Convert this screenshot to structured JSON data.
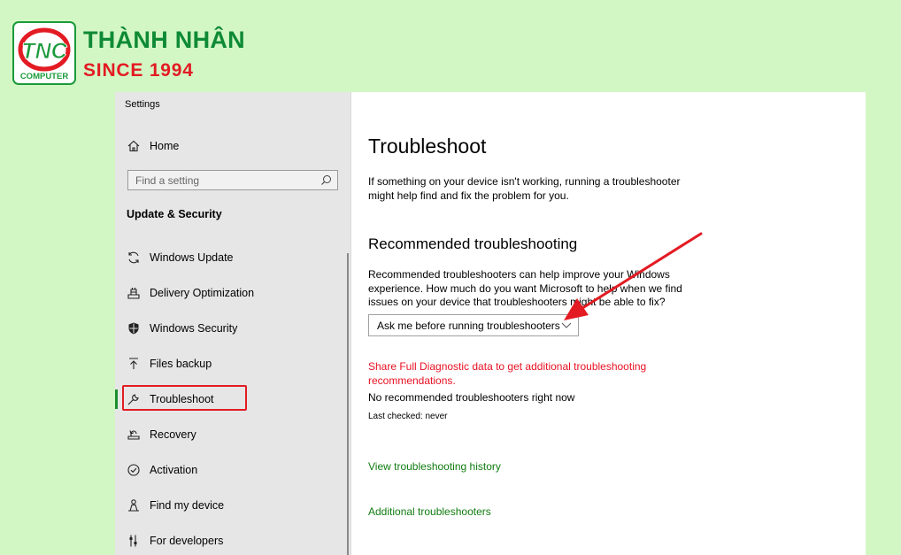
{
  "brand": {
    "logo_text": "TNC",
    "logo_subtext": "COMPUTER",
    "name": "THÀNH NHÂN",
    "since": "SINCE 1994",
    "colors": {
      "green": "#1b9a3b",
      "red": "#e31b23"
    }
  },
  "window": {
    "title": "Settings"
  },
  "sidebar": {
    "home": {
      "label": "Home",
      "icon": "home-icon"
    },
    "search": {
      "placeholder": "Find a setting",
      "icon": "search-icon"
    },
    "section_heading": "Update & Security",
    "items": [
      {
        "label": "Windows Update",
        "icon": "refresh-icon"
      },
      {
        "label": "Delivery Optimization",
        "icon": "delivery-optimization-icon"
      },
      {
        "label": "Windows Security",
        "icon": "shield-icon"
      },
      {
        "label": "Files backup",
        "icon": "backup-arrow-icon"
      },
      {
        "label": "Troubleshoot",
        "icon": "wrench-icon",
        "selected": true
      },
      {
        "label": "Recovery",
        "icon": "recovery-icon"
      },
      {
        "label": "Activation",
        "icon": "check-circle-icon"
      },
      {
        "label": "Find my device",
        "icon": "person-locate-icon"
      },
      {
        "label": "For developers",
        "icon": "developer-sliders-icon"
      }
    ],
    "selected_color": "#1b8f2e"
  },
  "content": {
    "title": "Troubleshoot",
    "intro": "If something on your device isn't working, running a troubleshooter might help find and fix the problem for you.",
    "recommended_heading": "Recommended troubleshooting",
    "recommended_desc": "Recommended troubleshooters can help improve your Windows experience. How much do you want Microsoft to help when we find issues on your device that troubleshooters might be able to fix?",
    "dropdown_selected": "Ask me before running troubleshooters",
    "diagnostic_link": "Share Full Diagnostic data to get additional troubleshooting recommendations.",
    "no_recommended": "No recommended troubleshooters right now",
    "last_checked": "Last checked: never",
    "history_link": "View troubleshooting history",
    "additional_link": "Additional troubleshooters",
    "colors": {
      "warning_link": "#e81123",
      "link": "#107c10",
      "annotation": "#e31b23"
    }
  }
}
